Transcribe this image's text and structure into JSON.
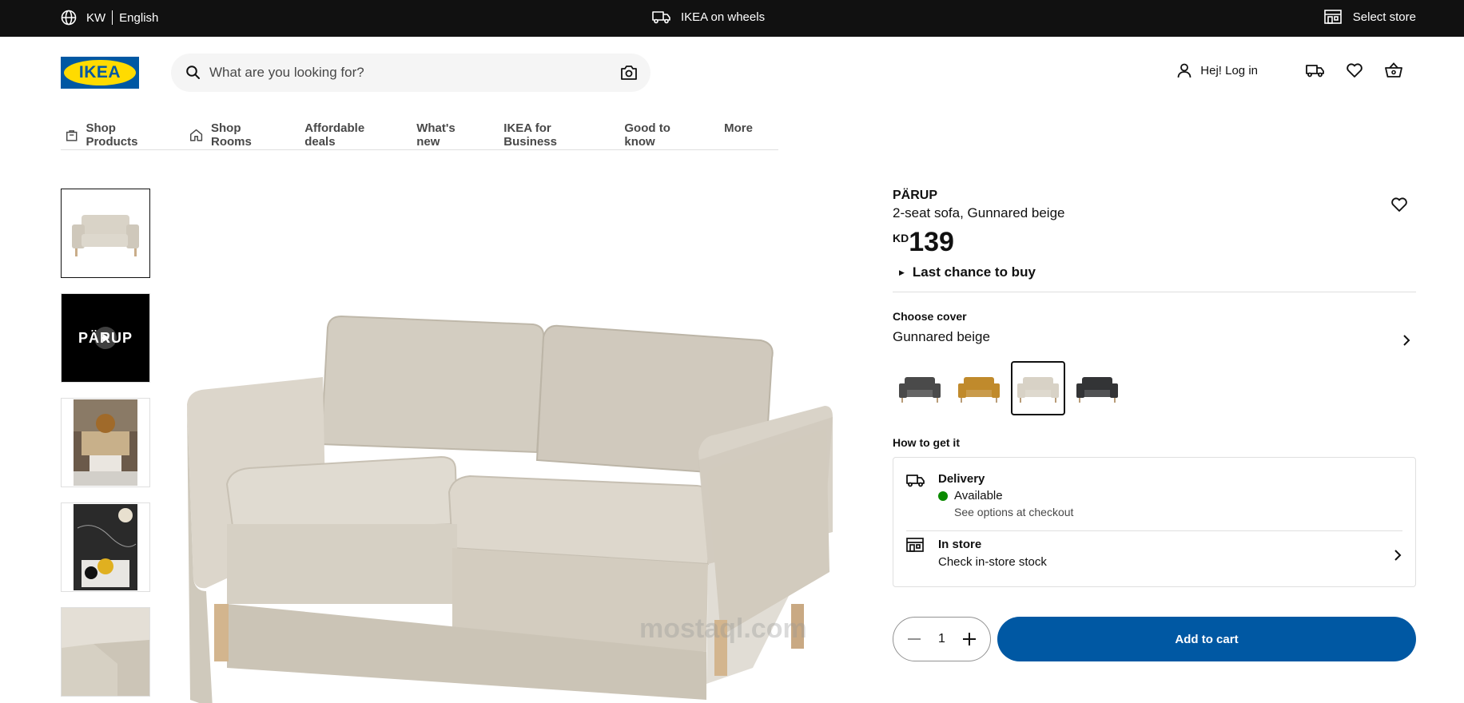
{
  "topbar": {
    "country": "KW",
    "language": "English",
    "promo": "IKEA on wheels",
    "select_store": "Select store"
  },
  "header": {
    "logo_text": "IKEA",
    "search_placeholder": "What are you looking for?",
    "login": "Hej! Log in"
  },
  "nav": {
    "items": [
      "Shop Products",
      "Shop Rooms",
      "Affordable deals",
      "What's new",
      "IKEA for Business",
      "Good to know",
      "More"
    ]
  },
  "gallery": {
    "video_thumb_text": "PÄRUP",
    "watermark": "mostaql.com"
  },
  "product": {
    "name": "PÄRUP",
    "description": "2-seat sofa, Gunnared beige",
    "currency": "KD",
    "price": "139",
    "last_chance": "Last chance to buy",
    "cover_label": "Choose cover",
    "cover_value": "Gunnared beige",
    "swatch_colors": [
      "#4a4a4a",
      "#c08a2c",
      "#d8d2c6",
      "#333436"
    ],
    "selected_swatch": 2
  },
  "availability": {
    "heading": "How to get it",
    "delivery_title": "Delivery",
    "delivery_status": "Available",
    "delivery_note": "See options at checkout",
    "instore_title": "In store",
    "instore_sub": "Check in-store stock"
  },
  "buy": {
    "quantity": "1",
    "add_to_cart": "Add to cart"
  },
  "colors": {
    "brand_blue": "#0058a3",
    "brand_yellow": "#ffdb00",
    "available_green": "#0a8a00"
  }
}
